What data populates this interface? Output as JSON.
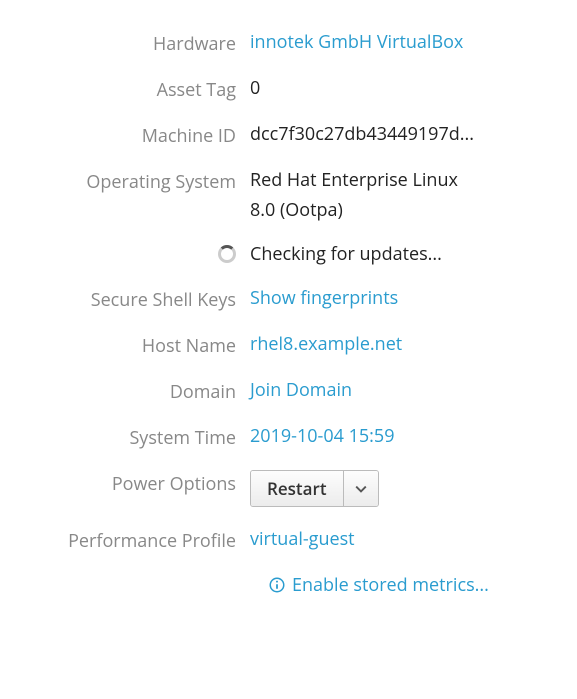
{
  "labels": {
    "hardware": "Hardware",
    "asset_tag": "Asset Tag",
    "machine_id": "Machine ID",
    "os": "Operating System",
    "ssh_keys": "Secure Shell Keys",
    "host_name": "Host Name",
    "domain": "Domain",
    "system_time": "System Time",
    "power_options": "Power Options",
    "perf_profile": "Performance Profile"
  },
  "values": {
    "hardware": "innotek GmbH VirtualBox",
    "asset_tag": "0",
    "machine_id": "dcc7f30c27db43449197d...",
    "os_line1": "Red Hat Enterprise Linux",
    "os_line2": "8.0 (Ootpa)",
    "update_status": "Checking for updates...",
    "ssh_keys_action": "Show fingerprints",
    "host_name": "rhel8.example.net",
    "domain_action": "Join Domain",
    "system_time": "2019-10-04 15:59",
    "power_button": "Restart",
    "perf_profile": "virtual-guest",
    "enable_metrics": "Enable stored metrics..."
  }
}
